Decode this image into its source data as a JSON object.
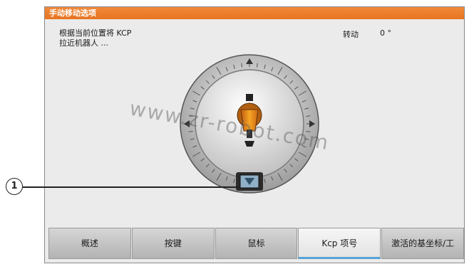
{
  "window": {
    "title": "手动移动选项",
    "info_text_line1": "根据当前位置将 KCP",
    "info_text_line2": "拉近机器人 ...",
    "rotation_label": "转动",
    "rotation_value": "0 °"
  },
  "watermark": "www.zr-robot.com",
  "callout": "1",
  "tabs": [
    {
      "label": "概述"
    },
    {
      "label": "按键"
    },
    {
      "label": "鼠标"
    },
    {
      "label": "Kcp 项号"
    },
    {
      "label": "激活的基坐标/工"
    }
  ],
  "active_tab_index": 3,
  "colors": {
    "title_bar": "#e8741f",
    "active_tab_indicator": "#5aa3d6"
  }
}
